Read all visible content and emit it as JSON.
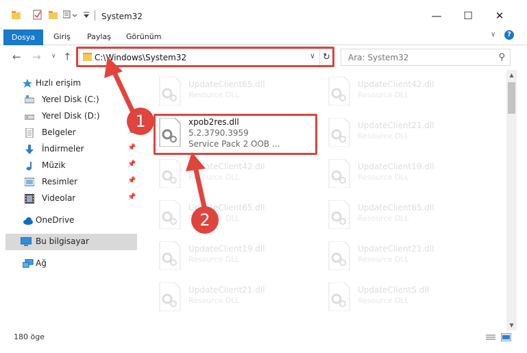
{
  "window": {
    "title": "System32",
    "minimize_icon": "minimize-icon",
    "maximize_icon": "maximize-icon",
    "close_icon": "close-icon"
  },
  "ribbon": {
    "tabs": [
      "Dosya",
      "Giriş",
      "Paylaş",
      "Görünüm"
    ]
  },
  "address": {
    "path": "C:\\Windows\\System32",
    "search_placeholder": "Ara: System32"
  },
  "sidebar": {
    "items": [
      {
        "label": "Hızlı erişim",
        "icon": "star-icon"
      },
      {
        "label": "Yerel Disk (C:)",
        "icon": "drive-icon"
      },
      {
        "label": "Yerel Disk (D:)",
        "icon": "drive-icon"
      },
      {
        "label": "Belgeler",
        "icon": "documents-icon"
      },
      {
        "label": "İndirmeler",
        "icon": "download-icon"
      },
      {
        "label": "Müzik",
        "icon": "music-icon"
      },
      {
        "label": "Resimler",
        "icon": "pictures-icon"
      },
      {
        "label": "Videolar",
        "icon": "videos-icon"
      },
      {
        "label": "OneDrive",
        "icon": "cloud-icon"
      },
      {
        "label": "Bu bilgisayar",
        "icon": "computer-icon"
      },
      {
        "label": "Ağ",
        "icon": "network-icon"
      }
    ]
  },
  "files": {
    "left": [
      {
        "name": "UpdateClient65.dll",
        "desc": "Resource DLL"
      },
      {
        "name": "xpob2res.dll",
        "version": "5.2.3790.3959",
        "desc": "Service Pack 2 OOB ..."
      },
      {
        "name": "UpdateClient42.dll",
        "desc": "Resource DLL"
      },
      {
        "name": "UpdateClient65.dll",
        "desc": "Resource DLL"
      },
      {
        "name": "UpdateClient19.dll",
        "desc": "Resource DLL"
      },
      {
        "name": "UpdateClient21.dll",
        "desc": "Resource DLL"
      }
    ],
    "right": [
      {
        "name": "UpdateClient42.dll",
        "desc": "Resource DLL"
      },
      {
        "name": "UpdateClient21.dll",
        "desc": "Resource DLL"
      },
      {
        "name": "UpdateClient19.dll",
        "desc": "Resource DLL"
      },
      {
        "name": "UpdateClient65.dll",
        "desc": "Resource DLL"
      },
      {
        "name": "UpdateClient21.dll",
        "desc": "Resource DLL"
      },
      {
        "name": "UpdateClient5.dll",
        "desc": "Resource DLL"
      }
    ]
  },
  "status": {
    "count": "180 öge"
  },
  "annotations": {
    "badge1": "1",
    "badge2": "2",
    "color": "#e0443d"
  }
}
